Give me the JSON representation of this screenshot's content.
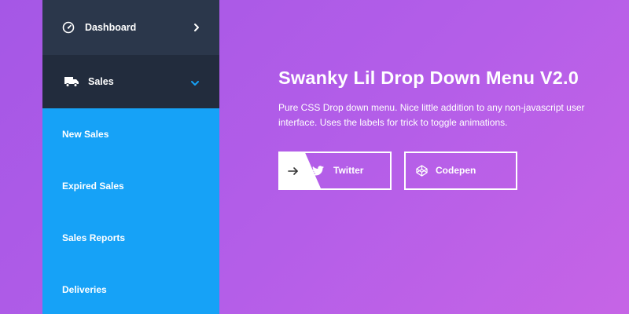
{
  "menu": {
    "dashboard": {
      "label": "Dashboard",
      "icon": "gauge-icon"
    },
    "sales": {
      "label": "Sales",
      "icon": "truck-icon"
    },
    "sub_items": [
      {
        "label": "New Sales"
      },
      {
        "label": "Expired Sales"
      },
      {
        "label": "Sales Reports"
      },
      {
        "label": "Deliveries"
      }
    ]
  },
  "main": {
    "title": "Swanky Lil Drop Down Menu V2.0",
    "description": "Pure CSS Drop down menu. Nice little addition to any non-javascript user interface. Uses the labels for trick to toggle animations.",
    "buttons": {
      "twitter": {
        "label": "Twitter",
        "icon": "twitter-icon"
      },
      "codepen": {
        "label": "Codepen",
        "icon": "codepen-icon"
      }
    }
  },
  "colors": {
    "background_start": "#a557e6",
    "background_end": "#c664e6",
    "menu_blue": "#16a2f7",
    "dashboard_row": "#2b374b",
    "sales_row": "#222c3d",
    "chevron_active": "#16a2f7"
  }
}
